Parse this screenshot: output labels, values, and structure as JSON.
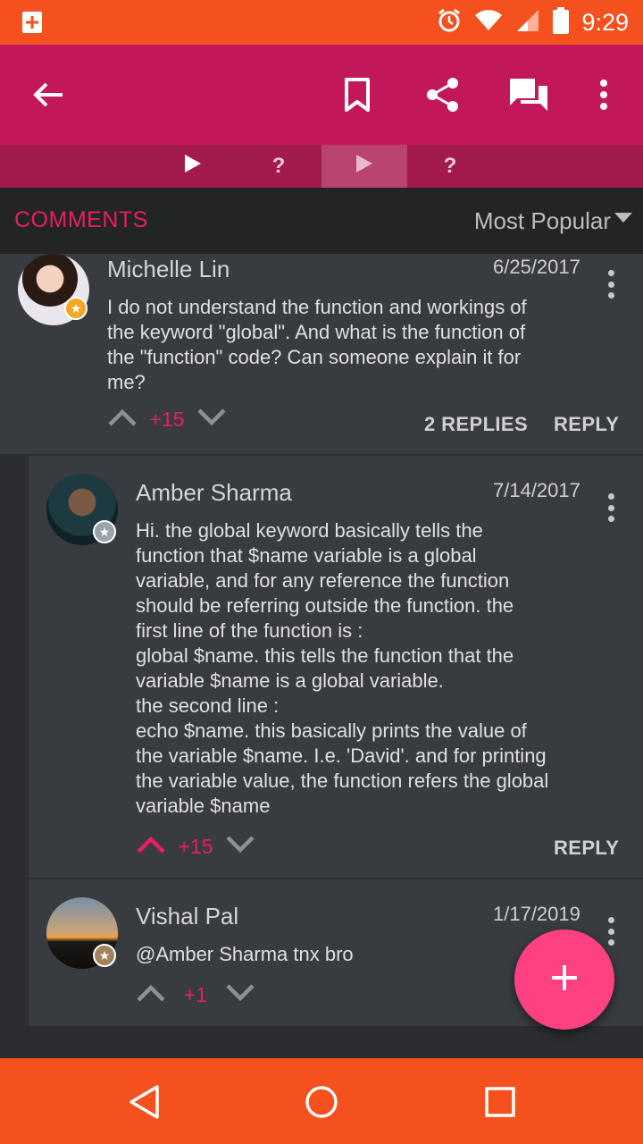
{
  "status_bar": {
    "time": "9:29"
  },
  "tabs": [
    {
      "label": "?"
    },
    {
      "label": "?"
    }
  ],
  "comments_header": {
    "title": "COMMENTS",
    "sort_label": "Most Popular"
  },
  "comments": [
    {
      "author": "Michelle Lin",
      "date": "6/25/2017",
      "text": "I do not understand the function and workings of\nthe keyword \"global\". And what is the function of\nthe \"function\" code? Can someone explain it for\nme?",
      "score": "+15",
      "replies_label": "2 REPLIES",
      "reply_label": "REPLY"
    },
    {
      "author": "Amber Sharma",
      "date": "7/14/2017",
      "text": "Hi. the global keyword basically tells the\nfunction that $name variable is a global\nvariable, and for any reference the function\nshould be referring outside the function. the\nfirst line of the function is :\nglobal $name. this tells the function that the\nvariable $name is a global variable.\nthe second line :\necho $name. this basically prints the value of\nthe variable $name. I.e. 'David'. and for printing\nthe variable value, the function refers the global\nvariable $name",
      "score": "+15",
      "reply_label": "REPLY"
    },
    {
      "author": "Vishal Pal",
      "date": "1/17/2019",
      "text": "@Amber Sharma tnx bro",
      "score": "+1"
    }
  ],
  "colors": {
    "status_bar": "#f4511e",
    "app_bar": "#c2185b",
    "accent": "#e91e63",
    "fab": "#ff4081"
  },
  "icons": {
    "app_bar": [
      "back-arrow-icon",
      "bookmark-icon",
      "share-icon",
      "discussion-icon",
      "more-vert-icon"
    ],
    "tabs": [
      "play-icon",
      "play-icon"
    ],
    "nav": [
      "back-triangle-icon",
      "home-circle-icon",
      "recents-square-icon"
    ],
    "fab": "plus-icon"
  }
}
